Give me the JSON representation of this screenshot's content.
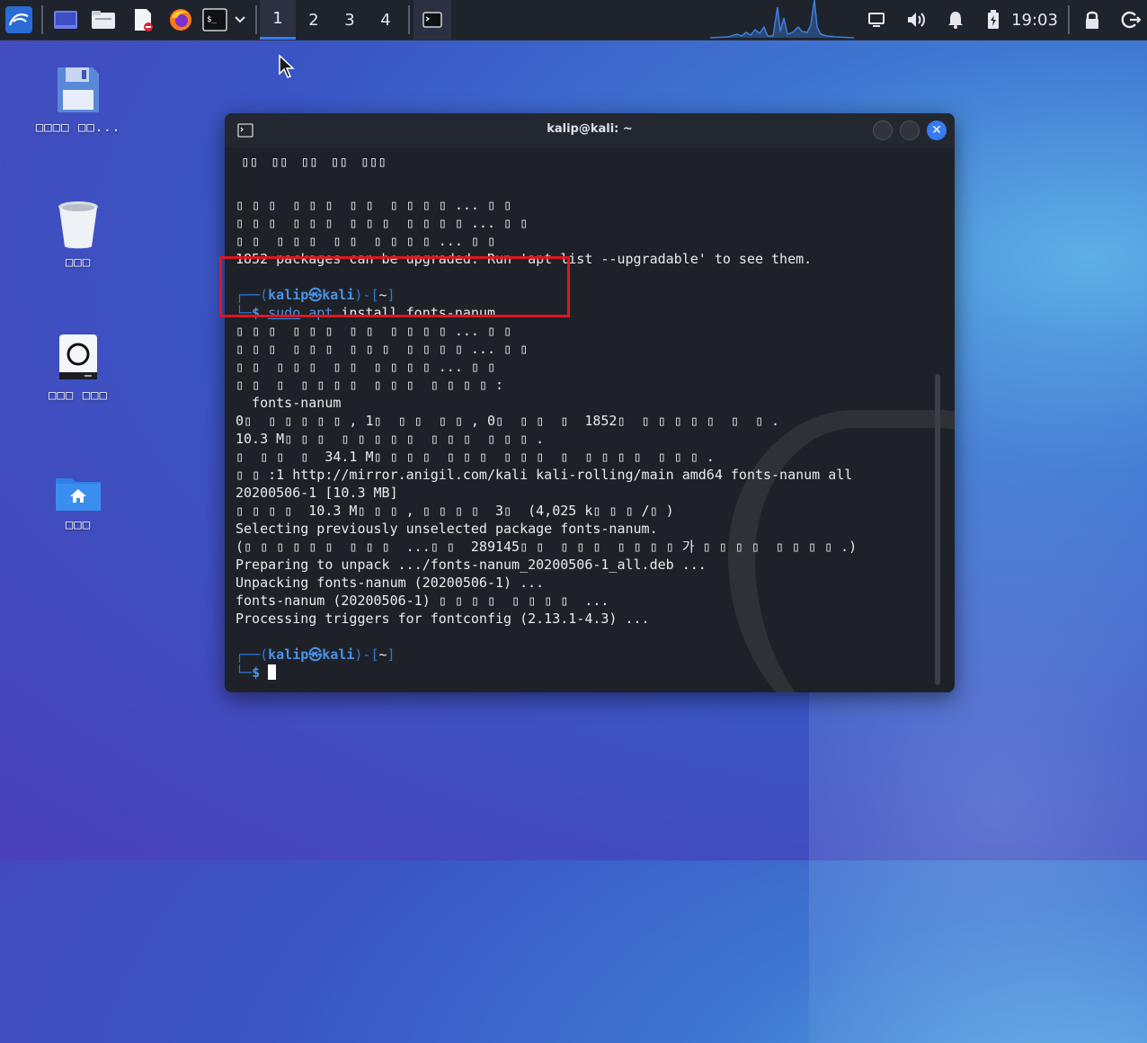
{
  "taskbar": {
    "workspaces": [
      "1",
      "2",
      "3",
      "4"
    ],
    "active_workspace": "1",
    "clock": "19:03",
    "accent": "#367bf0"
  },
  "desktop": {
    "icons": [
      {
        "name": "floppy-disk-icon",
        "label": "□□□□ □□..."
      },
      {
        "name": "trash-icon",
        "label": "□□□"
      },
      {
        "name": "drive-icon",
        "label": "□□□ □□□"
      },
      {
        "name": "home-folder-icon",
        "label": "□□□"
      }
    ]
  },
  "terminal": {
    "title": "kalip@kali: ~",
    "menu": [
      "▯▯",
      "▯▯",
      "▯▯",
      "▯▯",
      "▯▯▯"
    ],
    "lines": [
      "▯ ▯ ▯  ▯ ▯ ▯  ▯ ▯  ▯ ▯ ▯ ▯ ... ▯ ▯",
      "▯ ▯ ▯  ▯ ▯ ▯  ▯ ▯ ▯  ▯ ▯ ▯ ▯ ... ▯ ▯",
      "▯ ▯  ▯ ▯ ▯  ▯ ▯  ▯ ▯ ▯ ▯ ... ▯ ▯",
      "1852 packages can be upgraded. Run 'apt list --upgradable' to see them."
    ],
    "prompt1": {
      "frame_top": "┌──(",
      "user": "kalip㉿kali",
      "frame_mid": ")-[",
      "dir": "~",
      "frame_end": "]",
      "frame_bottom": "└─",
      "dollar": "$ ",
      "sudo": "sudo",
      "apt": "apt",
      "rest": " install fonts-nanum"
    },
    "output": [
      "▯ ▯ ▯  ▯ ▯ ▯  ▯ ▯  ▯ ▯ ▯ ▯ ... ▯ ▯",
      "▯ ▯ ▯  ▯ ▯ ▯  ▯ ▯ ▯  ▯ ▯ ▯ ▯ ... ▯ ▯",
      "▯ ▯  ▯ ▯ ▯  ▯ ▯  ▯ ▯ ▯ ▯ ... ▯ ▯",
      "▯ ▯  ▯  ▯ ▯ ▯ ▯  ▯ ▯ ▯  ▯ ▯ ▯ ▯ :",
      "  fonts-nanum",
      "0▯  ▯ ▯ ▯ ▯ ▯ , 1▯  ▯ ▯  ▯ ▯ , 0▯  ▯ ▯  ▯  1852▯  ▯ ▯ ▯ ▯ ▯  ▯  ▯ .",
      "10.3 M▯ ▯ ▯  ▯ ▯ ▯ ▯ ▯  ▯ ▯ ▯  ▯ ▯ ▯ .",
      "▯  ▯ ▯  ▯  34.1 M▯ ▯ ▯ ▯  ▯ ▯ ▯  ▯ ▯ ▯  ▯  ▯ ▯ ▯ ▯  ▯ ▯ ▯ .",
      "▯ ▯ :1 http://mirror.anigil.com/kali kali-rolling/main amd64 fonts-nanum all",
      "20200506-1 [10.3 MB]",
      "▯ ▯ ▯ ▯  10.3 M▯ ▯ ▯ , ▯ ▯ ▯ ▯  3▯  (4,025 k▯ ▯ ▯ /▯ )",
      "Selecting previously unselected package fonts-nanum.",
      "(▯ ▯ ▯ ▯ ▯ ▯  ▯ ▯ ▯  ...▯ ▯  289145▯ ▯  ▯ ▯ ▯  ▯ ▯ ▯ ▯ 가 ▯ ▯ ▯ ▯  ▯ ▯ ▯ ▯ .)",
      "Preparing to unpack .../fonts-nanum_20200506-1_all.deb ...",
      "Unpacking fonts-nanum (20200506-1) ...",
      "fonts-nanum (20200506-1) ▯ ▯ ▯ ▯  ▯ ▯ ▯ ▯  ...",
      "Processing triggers for fontconfig (2.13.1-4.3) ..."
    ],
    "prompt2": {
      "frame_top": "┌──(",
      "user": "kalip㉿kali",
      "frame_mid": ")-[",
      "dir": "~",
      "frame_end": "]",
      "frame_bottom": "└─",
      "dollar": "$ "
    }
  }
}
